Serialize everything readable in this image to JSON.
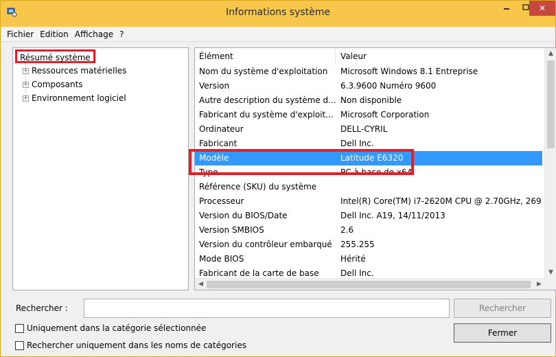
{
  "window": {
    "title": "Informations système",
    "colors": {
      "titlebar": "#f7c64a",
      "close_button": "#c7483c",
      "selection": "#3399ff",
      "highlight_box": "#e0202a"
    }
  },
  "titlebar_controls": {
    "minimize_icon": "minimize-icon",
    "maximize_icon": "maximize-icon",
    "close_label": "✕"
  },
  "menu": {
    "items": [
      {
        "label": "Fichier"
      },
      {
        "label": "Edition"
      },
      {
        "label": "Affichage"
      },
      {
        "label": "?"
      }
    ]
  },
  "tree": {
    "root_label": "Résumé système",
    "items": [
      {
        "label": "Ressources matérielles",
        "expander": "+"
      },
      {
        "label": "Composants",
        "expander": "+"
      },
      {
        "label": "Environnement logiciel",
        "expander": "+"
      }
    ]
  },
  "list": {
    "headers": {
      "element": "Élément",
      "value": "Valeur"
    },
    "rows": [
      {
        "element": "Nom du système d'exploitation",
        "value": "Microsoft Windows 8.1 Entreprise"
      },
      {
        "element": "Version",
        "value": "6.3.9600 Numéro 9600"
      },
      {
        "element": "Autre description du système d...",
        "value": "Non disponible"
      },
      {
        "element": "Fabricant du système d'exploit...",
        "value": "Microsoft Corporation"
      },
      {
        "element": "Ordinateur",
        "value": "DELL-CYRIL"
      },
      {
        "element": "Fabricant",
        "value": "Dell Inc."
      },
      {
        "element": "Modèle",
        "value": "Latitude E6320",
        "selected": true
      },
      {
        "element": "Type",
        "value": "PC à base de x64"
      },
      {
        "element": "Référence (SKU) du système",
        "value": ""
      },
      {
        "element": "Processeur",
        "value": "Intel(R) Core(TM) i7-2620M CPU @ 2.70GHz, 269"
      },
      {
        "element": "Version du BIOS/Date",
        "value": "Dell Inc. A19, 14/11/2013"
      },
      {
        "element": "Version SMBIOS",
        "value": "2.6"
      },
      {
        "element": "Version du contrôleur embarqué",
        "value": "255.255"
      },
      {
        "element": "Mode BIOS",
        "value": "Hérité"
      },
      {
        "element": "Fabricant de la carte de base",
        "value": "Dell Inc."
      }
    ],
    "scroll": {
      "up": "▲",
      "down": "▼",
      "left": "◀",
      "right": "▶"
    }
  },
  "search": {
    "label": "Rechercher :",
    "input_value": "",
    "button_label": "Rechercher",
    "close_button_label": "Fermer",
    "option_1": "Uniquement dans la catégorie sélectionnée",
    "option_2": "Rechercher uniquement dans les noms de catégories"
  }
}
